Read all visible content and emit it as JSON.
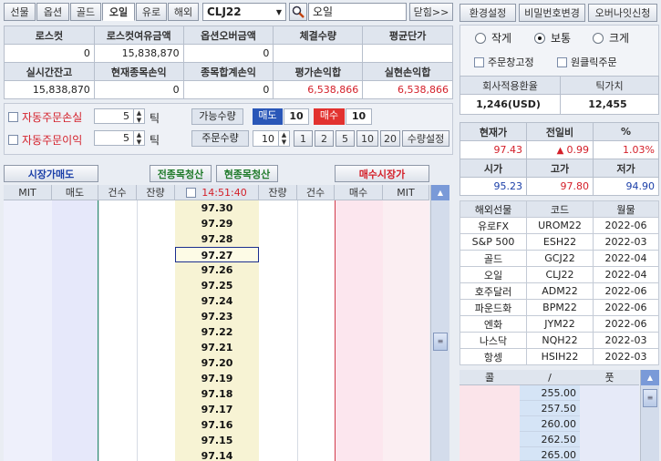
{
  "tabs": [
    "선물",
    "옵션",
    "골드",
    "오일",
    "유로",
    "해외"
  ],
  "active_tab": "오일",
  "code_input": "CLJ22",
  "search_name": "오일",
  "close_label": "닫힘>>",
  "top_buttons": [
    "환경설정",
    "비밀번호변경",
    "오버나잇신청"
  ],
  "summary": {
    "headers1": [
      "로스컷",
      "로스컷여유금액",
      "옵션오버금액",
      "체결수량",
      "평균단가"
    ],
    "values1": [
      "0",
      "15,838,870",
      "0",
      "",
      ""
    ],
    "headers2": [
      "실시간잔고",
      "현재종목손익",
      "종목합계손익",
      "평가손익합",
      "실현손익합"
    ],
    "values2": [
      "15,838,870",
      "0",
      "0",
      "6,538,866",
      "6,538,866"
    ]
  },
  "auto": {
    "loss_label": "자동주문손실",
    "loss_value": "5",
    "profit_label": "자동주문이익",
    "profit_value": "5",
    "unit": "틱"
  },
  "order": {
    "avail_label": "가능수량",
    "sell_label": "매도",
    "sell_qty": "10",
    "buy_label": "매수",
    "buy_qty": "10",
    "qty_label": "주문수량",
    "qty_value": "10",
    "qty_buttons": [
      "1",
      "2",
      "5",
      "10",
      "20"
    ],
    "qty_setting": "수량설정"
  },
  "size_options": {
    "small": "작게",
    "normal": "보통",
    "large": "크게",
    "selected": "보통"
  },
  "options_checks": {
    "fix_window": "주문창고정",
    "one_click": "원클릭주문"
  },
  "rate": {
    "label": "회사적용환율",
    "tick_label": "틱가치",
    "value": "1,246(USD)",
    "tick_value": "12,455"
  },
  "quote": {
    "h1": [
      "현재가",
      "전일비",
      "%"
    ],
    "v1": [
      "97.43",
      "0.99",
      "1.03%"
    ],
    "h2": [
      "시가",
      "고가",
      "저가"
    ],
    "v2": [
      "95.23",
      "97.80",
      "94.90"
    ]
  },
  "buttons": {
    "market_sell": "시장가매도",
    "close_all": "전종목청산",
    "close_current": "현종목청산",
    "market_buy": "매수시장가"
  },
  "ladder": {
    "headers": [
      "MIT",
      "매도",
      "건수",
      "잔량",
      "14:51:40",
      "잔량",
      "건수",
      "매수",
      "MIT"
    ],
    "prices": [
      "97.30",
      "97.29",
      "97.28",
      "97.27",
      "97.26",
      "97.25",
      "97.24",
      "97.23",
      "97.22",
      "97.21",
      "97.20",
      "97.19",
      "97.18",
      "97.17",
      "97.16",
      "97.15",
      "97.14"
    ],
    "selected_price": "97.27"
  },
  "futures": {
    "headers": [
      "해외선물",
      "코드",
      "월물"
    ],
    "rows": [
      [
        "유로FX",
        "UROM22",
        "2022-06"
      ],
      [
        "S&P 500",
        "ESH22",
        "2022-03"
      ],
      [
        "골드",
        "GCJ22",
        "2022-04"
      ],
      [
        "오일",
        "CLJ22",
        "2022-04"
      ],
      [
        "호주달러",
        "ADM22",
        "2022-06"
      ],
      [
        "파운드화",
        "BPM22",
        "2022-06"
      ],
      [
        "엔화",
        "JYM22",
        "2022-06"
      ],
      [
        "나스닥",
        "NQH22",
        "2022-03"
      ],
      [
        "항셍",
        "HSIH22",
        "2022-03"
      ]
    ]
  },
  "options_board": {
    "headers": [
      "콜",
      "/",
      "풋"
    ],
    "strikes": [
      "255.00",
      "257.50",
      "260.00",
      "262.50",
      "265.00"
    ]
  },
  "colors": {
    "red": "#d4202a",
    "blue": "#1b3fa8",
    "sell_bg": "#e6e8fa",
    "buy_bg": "#fce6ee",
    "price_bg": "#f7f3d4"
  }
}
